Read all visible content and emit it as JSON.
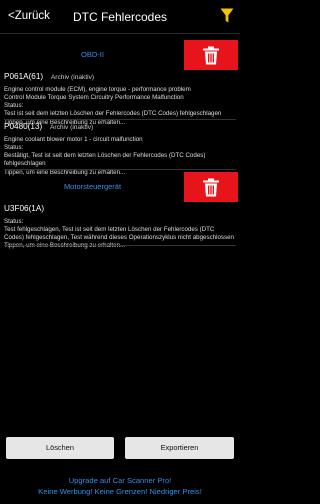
{
  "header": {
    "back_label": "<Zurück",
    "title": "DTC Fehlercodes",
    "filter_icon": "filter-icon"
  },
  "sections": [
    {
      "label": "OBD-II",
      "delete_icon": "trash-icon",
      "codes": [
        {
          "code": "P061A(61)",
          "state": "Archiv (inaktiv)",
          "desc": [
            "Engine control module (ECM), engine torque - performance problem",
            "Control Module Torque System Circuitry Performance Malfunction"
          ],
          "status_label": "Status:",
          "status": "Test ist seit dem letzten Löschen der Fehlercodes (DTC Codes) fehlgeschlagen",
          "hint": "Tippen, um eine Beschreibung zu erhalten..."
        },
        {
          "code": "P0480(13)",
          "state": "Archiv (inaktiv)",
          "desc": [
            "Engine coolant blower motor 1 - circuit malfunction"
          ],
          "status_label": "Status:",
          "status": "Bestätigt, Test ist seit dem letzten Löschen der Fehlercodes (DTC Codes) fehlgeschlagen",
          "hint": "Tippen, um eine Beschreibung zu erhalten..."
        }
      ]
    },
    {
      "label": "Motorsteuergerät",
      "delete_icon": "trash-icon",
      "codes": [
        {
          "code": "U3F06(1A)",
          "state": "",
          "desc": [],
          "status_label": "Status:",
          "status": "Test fehlgeschlagen, Test ist seit dem letzten Löschen der Fehlercodes (DTC Codes) fehlgeschlagen, Test während dieses Operationszyklus nicht abgeschlossen",
          "hint": "Tippen, um eine Beschreibung zu erhalten..."
        }
      ]
    }
  ],
  "actions": {
    "clear_label": "Löschen",
    "export_label": "Exportieren"
  },
  "promo": {
    "line1": "Upgrade auf Car Scanner Pro!",
    "line2": "Keine Werbung! Keine Grenzen! Niedriger Preis!"
  },
  "colors": {
    "accent": "#3a8fe6",
    "delete": "#e8141b",
    "filter": "#f5c400"
  }
}
